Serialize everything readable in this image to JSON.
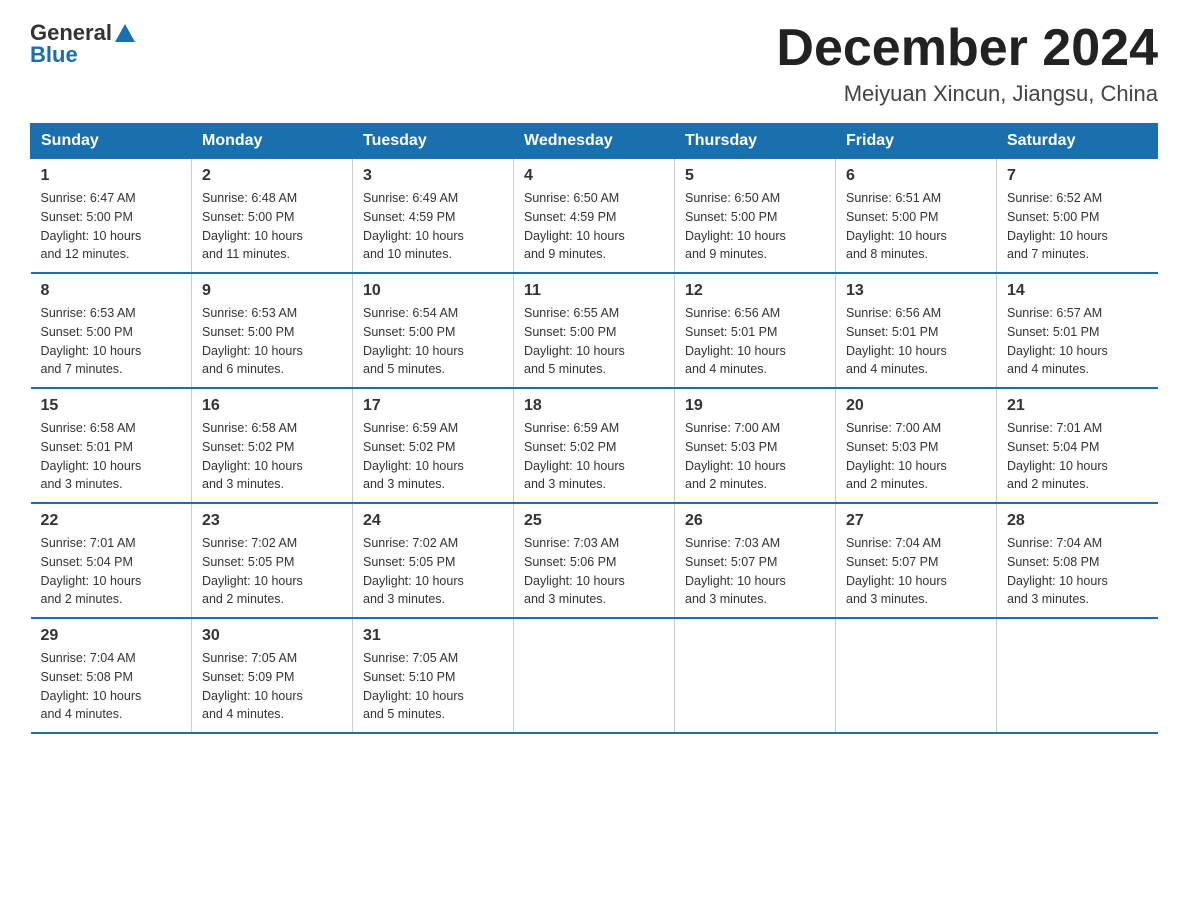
{
  "logo": {
    "text_general": "General",
    "text_blue": "Blue"
  },
  "header": {
    "title": "December 2024",
    "location": "Meiyuan Xincun, Jiangsu, China"
  },
  "days_of_week": [
    "Sunday",
    "Monday",
    "Tuesday",
    "Wednesday",
    "Thursday",
    "Friday",
    "Saturday"
  ],
  "weeks": [
    [
      {
        "day": "1",
        "sunrise": "6:47 AM",
        "sunset": "5:00 PM",
        "daylight": "10 hours and 12 minutes."
      },
      {
        "day": "2",
        "sunrise": "6:48 AM",
        "sunset": "5:00 PM",
        "daylight": "10 hours and 11 minutes."
      },
      {
        "day": "3",
        "sunrise": "6:49 AM",
        "sunset": "4:59 PM",
        "daylight": "10 hours and 10 minutes."
      },
      {
        "day": "4",
        "sunrise": "6:50 AM",
        "sunset": "4:59 PM",
        "daylight": "10 hours and 9 minutes."
      },
      {
        "day": "5",
        "sunrise": "6:50 AM",
        "sunset": "5:00 PM",
        "daylight": "10 hours and 9 minutes."
      },
      {
        "day": "6",
        "sunrise": "6:51 AM",
        "sunset": "5:00 PM",
        "daylight": "10 hours and 8 minutes."
      },
      {
        "day": "7",
        "sunrise": "6:52 AM",
        "sunset": "5:00 PM",
        "daylight": "10 hours and 7 minutes."
      }
    ],
    [
      {
        "day": "8",
        "sunrise": "6:53 AM",
        "sunset": "5:00 PM",
        "daylight": "10 hours and 7 minutes."
      },
      {
        "day": "9",
        "sunrise": "6:53 AM",
        "sunset": "5:00 PM",
        "daylight": "10 hours and 6 minutes."
      },
      {
        "day": "10",
        "sunrise": "6:54 AM",
        "sunset": "5:00 PM",
        "daylight": "10 hours and 5 minutes."
      },
      {
        "day": "11",
        "sunrise": "6:55 AM",
        "sunset": "5:00 PM",
        "daylight": "10 hours and 5 minutes."
      },
      {
        "day": "12",
        "sunrise": "6:56 AM",
        "sunset": "5:01 PM",
        "daylight": "10 hours and 4 minutes."
      },
      {
        "day": "13",
        "sunrise": "6:56 AM",
        "sunset": "5:01 PM",
        "daylight": "10 hours and 4 minutes."
      },
      {
        "day": "14",
        "sunrise": "6:57 AM",
        "sunset": "5:01 PM",
        "daylight": "10 hours and 4 minutes."
      }
    ],
    [
      {
        "day": "15",
        "sunrise": "6:58 AM",
        "sunset": "5:01 PM",
        "daylight": "10 hours and 3 minutes."
      },
      {
        "day": "16",
        "sunrise": "6:58 AM",
        "sunset": "5:02 PM",
        "daylight": "10 hours and 3 minutes."
      },
      {
        "day": "17",
        "sunrise": "6:59 AM",
        "sunset": "5:02 PM",
        "daylight": "10 hours and 3 minutes."
      },
      {
        "day": "18",
        "sunrise": "6:59 AM",
        "sunset": "5:02 PM",
        "daylight": "10 hours and 3 minutes."
      },
      {
        "day": "19",
        "sunrise": "7:00 AM",
        "sunset": "5:03 PM",
        "daylight": "10 hours and 2 minutes."
      },
      {
        "day": "20",
        "sunrise": "7:00 AM",
        "sunset": "5:03 PM",
        "daylight": "10 hours and 2 minutes."
      },
      {
        "day": "21",
        "sunrise": "7:01 AM",
        "sunset": "5:04 PM",
        "daylight": "10 hours and 2 minutes."
      }
    ],
    [
      {
        "day": "22",
        "sunrise": "7:01 AM",
        "sunset": "5:04 PM",
        "daylight": "10 hours and 2 minutes."
      },
      {
        "day": "23",
        "sunrise": "7:02 AM",
        "sunset": "5:05 PM",
        "daylight": "10 hours and 2 minutes."
      },
      {
        "day": "24",
        "sunrise": "7:02 AM",
        "sunset": "5:05 PM",
        "daylight": "10 hours and 3 minutes."
      },
      {
        "day": "25",
        "sunrise": "7:03 AM",
        "sunset": "5:06 PM",
        "daylight": "10 hours and 3 minutes."
      },
      {
        "day": "26",
        "sunrise": "7:03 AM",
        "sunset": "5:07 PM",
        "daylight": "10 hours and 3 minutes."
      },
      {
        "day": "27",
        "sunrise": "7:04 AM",
        "sunset": "5:07 PM",
        "daylight": "10 hours and 3 minutes."
      },
      {
        "day": "28",
        "sunrise": "7:04 AM",
        "sunset": "5:08 PM",
        "daylight": "10 hours and 3 minutes."
      }
    ],
    [
      {
        "day": "29",
        "sunrise": "7:04 AM",
        "sunset": "5:08 PM",
        "daylight": "10 hours and 4 minutes."
      },
      {
        "day": "30",
        "sunrise": "7:05 AM",
        "sunset": "5:09 PM",
        "daylight": "10 hours and 4 minutes."
      },
      {
        "day": "31",
        "sunrise": "7:05 AM",
        "sunset": "5:10 PM",
        "daylight": "10 hours and 5 minutes."
      },
      null,
      null,
      null,
      null
    ]
  ],
  "labels": {
    "sunrise": "Sunrise:",
    "sunset": "Sunset:",
    "daylight": "Daylight:"
  }
}
